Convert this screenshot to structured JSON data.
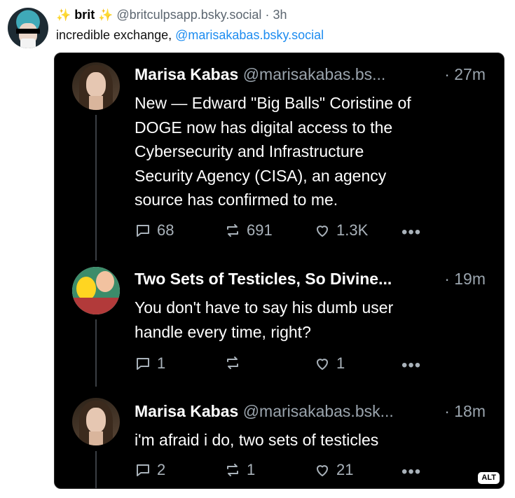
{
  "outer_post": {
    "display_name": "brit",
    "sparkle_glyph": "✨",
    "handle": "@britculpsapp.bsky.social",
    "separator": "·",
    "time": "3h",
    "text": "incredible exchange, ",
    "mention": "@marisakabas.bsky.social"
  },
  "embed": {
    "alt_badge": "ALT",
    "posts": [
      {
        "author": "Marisa Kabas",
        "handle": "@marisakabas.bs...",
        "time": "· 27m",
        "text": "New — Edward \"Big Balls\" Coristine of\nDOGE now has digital access to the\nCybersecurity and Infrastructure\nSecurity Agency (CISA), an agency\nsource has confirmed to me.",
        "replies": "68",
        "reposts": "691",
        "likes": "1.3K",
        "more": "•••"
      },
      {
        "author": "Two Sets of Testicles, So Divine...",
        "handle": "",
        "time": "· 19m",
        "text": "You don't have to say his dumb user\nhandle every time, right?",
        "replies": "1",
        "reposts": "",
        "likes": "1",
        "more": "•••"
      },
      {
        "author": "Marisa Kabas",
        "handle": "@marisakabas.bsk...",
        "time": "· 18m",
        "text": "i'm afraid i do, two sets of testicles",
        "replies": "2",
        "reposts": "1",
        "likes": "21",
        "more": "•••"
      }
    ]
  },
  "icons": [
    "reply-icon",
    "repost-icon",
    "like-icon",
    "more-icon",
    "sparkle-icon"
  ],
  "colors": {
    "mention": "#1d8cf0",
    "embed_bg": "#000000",
    "muted": "#9aa4ad",
    "sparkle": "#e3b100"
  }
}
